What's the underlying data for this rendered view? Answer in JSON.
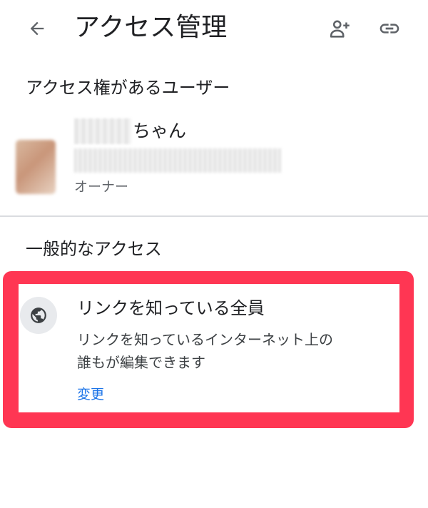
{
  "header": {
    "title": "アクセス管理",
    "back_icon": "arrow-back-icon",
    "add_user_icon": "person-add-icon",
    "link_icon": "link-icon"
  },
  "users_section": {
    "heading": "アクセス権があるユーザー",
    "users": [
      {
        "name_suffix": "ちゃん",
        "role": "オーナー"
      }
    ]
  },
  "general_access": {
    "heading": "一般的なアクセス",
    "icon": "globe-icon",
    "title": "リンクを知っている全員",
    "description_line1": "リンクを知っているインターネット上の",
    "description_line2": "誰もが編集できます",
    "change_label": "変更"
  },
  "colors": {
    "highlight": "#ff3653",
    "link": "#1a73e8",
    "icon": "#5f6368"
  }
}
